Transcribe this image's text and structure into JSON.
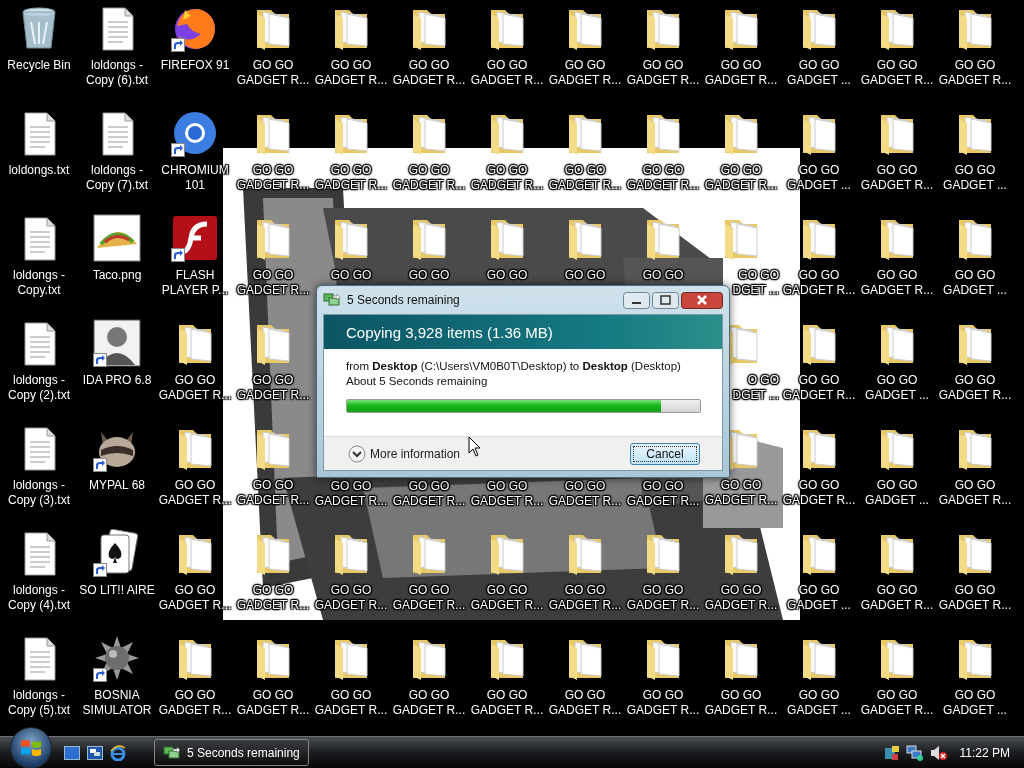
{
  "desktop": {
    "columns": [
      [
        {
          "kind": "recycle-bin",
          "lines": [
            "Recycle Bin"
          ],
          "shortcut": false
        },
        {
          "kind": "text-file",
          "lines": [
            "loldongs.txt"
          ],
          "shortcut": false
        },
        {
          "kind": "text-file",
          "lines": [
            "loldongs -",
            "Copy.txt"
          ],
          "shortcut": false
        },
        {
          "kind": "text-file",
          "lines": [
            "loldongs -",
            "Copy (2).txt"
          ],
          "shortcut": false
        },
        {
          "kind": "text-file",
          "lines": [
            "loldongs -",
            "Copy (3).txt"
          ],
          "shortcut": false
        },
        {
          "kind": "text-file",
          "lines": [
            "loldongs -",
            "Copy (4).txt"
          ],
          "shortcut": false
        },
        {
          "kind": "text-file",
          "lines": [
            "loldongs -",
            "Copy (5).txt"
          ],
          "shortcut": false
        }
      ],
      [
        {
          "kind": "text-file",
          "lines": [
            "loldongs -",
            "Copy (6).txt"
          ],
          "shortcut": false
        },
        {
          "kind": "text-file",
          "lines": [
            "loldongs -",
            "Copy (7).txt"
          ],
          "shortcut": false
        },
        {
          "kind": "taco",
          "lines": [
            "Taco.png"
          ],
          "shortcut": false
        },
        {
          "kind": "portrait",
          "lines": [
            "IDA PRO 6.8"
          ],
          "shortcut": true
        },
        {
          "kind": "raccoon",
          "lines": [
            "MYPAL 68"
          ],
          "shortcut": true
        },
        {
          "kind": "cards",
          "lines": [
            "SO LIT!! AIRE"
          ],
          "shortcut": true
        },
        {
          "kind": "spiked-ball",
          "lines": [
            "BOSNIA",
            "SIMULATOR"
          ],
          "shortcut": true
        }
      ],
      [
        {
          "kind": "fox-browser",
          "lines": [
            "FIREFOX 91"
          ],
          "shortcut": true
        },
        {
          "kind": "round-browser",
          "lines": [
            "CHROMIUM",
            "101"
          ],
          "shortcut": true
        },
        {
          "kind": "flash",
          "lines": [
            "FLASH",
            "PLAYER P..."
          ],
          "shortcut": true
        },
        {
          "kind": "folder",
          "lines": [
            "GO GO",
            "GADGET R..."
          ],
          "shortcut": false
        },
        {
          "kind": "folder",
          "lines": [
            "GO GO",
            "GADGET R..."
          ],
          "shortcut": false
        },
        {
          "kind": "folder",
          "lines": [
            "GO GO",
            "GADGET R..."
          ],
          "shortcut": false
        },
        {
          "kind": "folder",
          "lines": [
            "GO GO",
            "GADGET R..."
          ],
          "shortcut": false
        }
      ],
      [
        {
          "kind": "folder",
          "lines": [
            "GO GO",
            "GADGET R..."
          ],
          "shortcut": false
        },
        {
          "kind": "folder",
          "lines": [
            "GO GO",
            "GADGET R..."
          ],
          "shortcut": false
        },
        {
          "kind": "folder",
          "lines": [
            "GO GO",
            "GADGET R..."
          ],
          "shortcut": false
        },
        {
          "kind": "folder",
          "lines": [
            "GO GO",
            "GADGET R..."
          ],
          "shortcut": false
        },
        {
          "kind": "folder",
          "lines": [
            "GO GO",
            "GADGET R..."
          ],
          "shortcut": false
        },
        {
          "kind": "folder",
          "lines": [
            "GO GO",
            "GADGET R..."
          ],
          "shortcut": false
        },
        {
          "kind": "folder",
          "lines": [
            "GO GO",
            "GADGET R..."
          ],
          "shortcut": false
        }
      ],
      [
        {
          "kind": "folder",
          "lines": [
            "GO GO",
            "GADGET R..."
          ],
          "shortcut": false
        },
        {
          "kind": "folder",
          "lines": [
            "GO GO",
            "GADGET R..."
          ],
          "shortcut": false
        },
        {
          "kind": "folder",
          "lines": [
            "GO GO"
          ],
          "shortcut": false
        },
        {
          "kind": "covered"
        },
        {
          "kind": "label",
          "lines": [
            "GO GO",
            "GADGET R..."
          ]
        },
        {
          "kind": "folder",
          "lines": [
            "GO GO",
            "GADGET R..."
          ],
          "shortcut": false
        },
        {
          "kind": "folder",
          "lines": [
            "GO GO",
            "GADGET R..."
          ],
          "shortcut": false
        }
      ],
      [
        {
          "kind": "folder",
          "lines": [
            "GO GO",
            "GADGET R..."
          ],
          "shortcut": false
        },
        {
          "kind": "folder",
          "lines": [
            "GO GO",
            "GADGET R..."
          ],
          "shortcut": false
        },
        {
          "kind": "folder",
          "lines": [
            "GO GO"
          ],
          "shortcut": false
        },
        {
          "kind": "covered"
        },
        {
          "kind": "label",
          "lines": [
            "GO GO",
            "GADGET R..."
          ]
        },
        {
          "kind": "folder",
          "lines": [
            "GO GO",
            "GADGET R..."
          ],
          "shortcut": false
        },
        {
          "kind": "folder",
          "lines": [
            "GO GO",
            "GADGET R..."
          ],
          "shortcut": false
        }
      ],
      [
        {
          "kind": "folder",
          "lines": [
            "GO GO",
            "GADGET R..."
          ],
          "shortcut": false
        },
        {
          "kind": "folder",
          "lines": [
            "GO GO",
            "GADGET R..."
          ],
          "shortcut": false
        },
        {
          "kind": "folder",
          "lines": [
            "GO GO"
          ],
          "shortcut": false
        },
        {
          "kind": "covered"
        },
        {
          "kind": "label",
          "lines": [
            "GO GO",
            "GADGET R..."
          ]
        },
        {
          "kind": "folder",
          "lines": [
            "GO GO",
            "GADGET R..."
          ],
          "shortcut": false
        },
        {
          "kind": "folder",
          "lines": [
            "GO GO",
            "GADGET R..."
          ],
          "shortcut": false
        }
      ],
      [
        {
          "kind": "folder",
          "lines": [
            "GO GO",
            "GADGET R..."
          ],
          "shortcut": false
        },
        {
          "kind": "folder",
          "lines": [
            "GO GO",
            "GADGET R..."
          ],
          "shortcut": false
        },
        {
          "kind": "folder",
          "lines": [
            "GO GO"
          ],
          "shortcut": false
        },
        {
          "kind": "covered"
        },
        {
          "kind": "label",
          "lines": [
            "GO GO",
            "GADGET R..."
          ]
        },
        {
          "kind": "folder",
          "lines": [
            "GO GO",
            "GADGET R..."
          ],
          "shortcut": false
        },
        {
          "kind": "folder",
          "lines": [
            "GO GO",
            "GADGET R..."
          ],
          "shortcut": false
        }
      ],
      [
        {
          "kind": "folder",
          "lines": [
            "GO GO",
            "GADGET R..."
          ],
          "shortcut": false
        },
        {
          "kind": "folder",
          "lines": [
            "GO GO",
            "GADGET R..."
          ],
          "shortcut": false
        },
        {
          "kind": "folder",
          "lines": [
            "GO GO"
          ],
          "shortcut": false
        },
        {
          "kind": "covered"
        },
        {
          "kind": "label",
          "lines": [
            "GO GO",
            "GADGET R..."
          ]
        },
        {
          "kind": "folder",
          "lines": [
            "GO GO",
            "GADGET R..."
          ],
          "shortcut": false
        },
        {
          "kind": "folder",
          "lines": [
            "GO GO",
            "GADGET R..."
          ],
          "shortcut": false
        }
      ],
      [
        {
          "kind": "folder",
          "lines": [
            "GO GO",
            "GADGET R..."
          ],
          "shortcut": false
        },
        {
          "kind": "folder",
          "lines": [
            "GO GO",
            "GADGET R..."
          ],
          "shortcut": false
        },
        {
          "kind": "clipped",
          "lines": [
            "GO GO",
            "DGET ..."
          ]
        },
        {
          "kind": "clipped",
          "lines": [
            "O GO",
            "DGET ..."
          ]
        },
        {
          "kind": "folder",
          "lines": [
            "GO GO",
            "GADGET R..."
          ],
          "shortcut": false
        },
        {
          "kind": "folder",
          "lines": [
            "GO GO",
            "GADGET R..."
          ],
          "shortcut": false
        },
        {
          "kind": "folder",
          "lines": [
            "GO GO",
            "GADGET R..."
          ],
          "shortcut": false
        }
      ],
      [
        {
          "kind": "folder",
          "lines": [
            "GO GO",
            "GADGET ..."
          ],
          "shortcut": false
        },
        {
          "kind": "folder",
          "lines": [
            "GO GO",
            "GADGET ..."
          ],
          "shortcut": false
        },
        {
          "kind": "folder",
          "lines": [
            "GO GO",
            "GADGET R..."
          ],
          "shortcut": false
        },
        {
          "kind": "folder",
          "lines": [
            "GO GO",
            "GADGET R..."
          ],
          "shortcut": false
        },
        {
          "kind": "folder",
          "lines": [
            "GO GO",
            "GADGET R..."
          ],
          "shortcut": false
        },
        {
          "kind": "folder",
          "lines": [
            "GO GO",
            "GADGET ..."
          ],
          "shortcut": false
        },
        {
          "kind": "folder",
          "lines": [
            "GO GO",
            "GADGET ..."
          ],
          "shortcut": false
        }
      ],
      [
        {
          "kind": "folder",
          "lines": [
            "GO GO",
            "GADGET R..."
          ],
          "shortcut": false
        },
        {
          "kind": "folder",
          "lines": [
            "GO GO",
            "GADGET R..."
          ],
          "shortcut": false
        },
        {
          "kind": "folder",
          "lines": [
            "GO GO",
            "GADGET R..."
          ],
          "shortcut": false
        },
        {
          "kind": "folder",
          "lines": [
            "GO GO",
            "GADGET ..."
          ],
          "shortcut": false
        },
        {
          "kind": "folder",
          "lines": [
            "GO GO",
            "GADGET ..."
          ],
          "shortcut": false
        },
        {
          "kind": "folder",
          "lines": [
            "GO GO",
            "GADGET R..."
          ],
          "shortcut": false
        },
        {
          "kind": "folder",
          "lines": [
            "GO GO",
            "GADGET R..."
          ],
          "shortcut": false
        }
      ],
      [
        {
          "kind": "folder",
          "lines": [
            "GO GO",
            "GADGET R..."
          ],
          "shortcut": false
        },
        {
          "kind": "folder",
          "lines": [
            "GO GO",
            "GADGET ..."
          ],
          "shortcut": false
        },
        {
          "kind": "folder",
          "lines": [
            "GO GO",
            "GADGET ..."
          ],
          "shortcut": false
        },
        {
          "kind": "folder",
          "lines": [
            "GO GO",
            "GADGET R..."
          ],
          "shortcut": false
        },
        {
          "kind": "folder",
          "lines": [
            "GO GO",
            "GADGET R..."
          ],
          "shortcut": false
        },
        {
          "kind": "folder",
          "lines": [
            "GO GO",
            "GADGET R..."
          ],
          "shortcut": false
        },
        {
          "kind": "folder",
          "lines": [
            "GO GO",
            "GADGET ..."
          ],
          "shortcut": false
        }
      ]
    ]
  },
  "dialog": {
    "title": "5 Seconds remaining",
    "heading": "Copying 3,928 items (1.36 MB)",
    "detail": "from **Desktop** (C:\\Users\\VM0B0T\\Desktop) to **Desktop** (Desktop)",
    "status": "About 5 Seconds remaining",
    "progress": {
      "level": 0.89
    },
    "more_info": "More information",
    "cancel": "Cancel"
  },
  "taskbar": {
    "tasks": [
      {
        "label": "5 Seconds remaining",
        "selected": false
      }
    ],
    "clock": "11:22 PM"
  }
}
